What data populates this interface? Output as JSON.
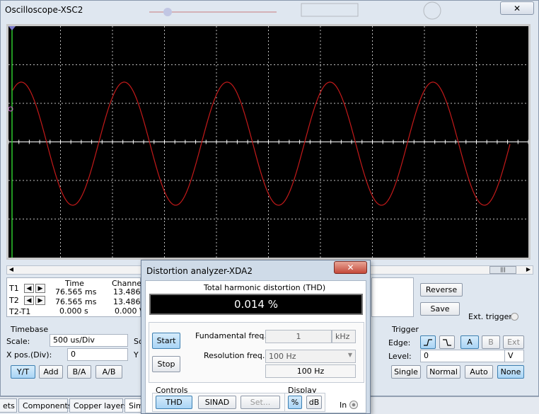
{
  "oscilloscope": {
    "title": "Oscilloscope-XSC2",
    "close_icon": "x-icon",
    "cursor_table": {
      "headers": [
        "Time",
        "Channel"
      ],
      "rows": [
        {
          "label": "T1",
          "time": "76.565 ms",
          "channel": "13.486"
        },
        {
          "label": "T2",
          "time": "76.565 ms",
          "channel": "13.486"
        },
        {
          "label": "T2-T1",
          "time": "0.000 s",
          "channel": "0.000 V"
        }
      ]
    },
    "reverse_label": "Reverse",
    "save_label": "Save",
    "ext_trigger_label": "Ext. trigger",
    "timebase": {
      "title": "Timebase",
      "scale_label": "Scale:",
      "scale_value": "500 us/Div",
      "xpos_label": "X pos.(Div):",
      "xpos_value": "0",
      "modes": [
        "Y/T",
        "Add",
        "B/A",
        "A/B"
      ],
      "active_mode": "Y/T"
    },
    "channel_partial": {
      "line1": "Sc",
      "line2": "Y"
    },
    "trigger": {
      "title": "Trigger",
      "edge_label": "Edge:",
      "sources": [
        "A",
        "B",
        "Ext"
      ],
      "active_source": "A",
      "level_label": "Level:",
      "level_value": "0",
      "level_unit": "V",
      "modes": [
        "Single",
        "Normal",
        "Auto",
        "None"
      ],
      "active_mode": "None"
    },
    "colors": {
      "trace": "#c41a1a",
      "screen": "#000000",
      "grid": "#bdbdbd",
      "cursor": "#2ec82e"
    }
  },
  "tabs": [
    "ets",
    "Components",
    "Copper layers",
    "Sim"
  ],
  "analyzer": {
    "title": "Distortion analyzer-XDA2",
    "close_icon": "close-x-icon",
    "thd_label": "Total harmonic distortion (THD)",
    "thd_value": "0.014 %",
    "start_label": "Start",
    "stop_label": "Stop",
    "fund_label": "Fundamental freq.",
    "fund_value": "1",
    "fund_unit": "kHz",
    "res_label": "Resolution freq.",
    "res_selected": "100 Hz",
    "res_readout": "100 Hz",
    "controls_label": "Controls",
    "thd_btn": "THD",
    "sinad_btn": "SINAD",
    "set_btn": "Set...",
    "display_label": "Display",
    "pct_btn": "%",
    "db_btn": "dB",
    "in_label": "In"
  }
}
